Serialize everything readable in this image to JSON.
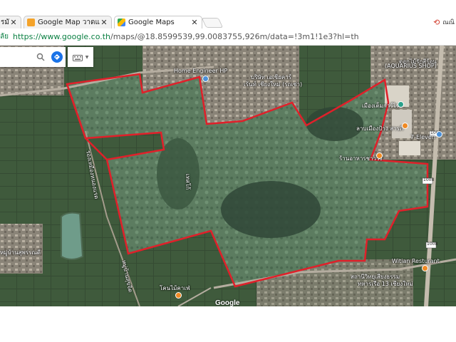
{
  "tabs": [
    {
      "label": "รมั",
      "favicon_color": "#ffffff",
      "close": "✕"
    },
    {
      "label": "Google Map วาดแปลงที่ดิน",
      "favicon_color": "#f4a32a",
      "close": "✕"
    },
    {
      "label": "Google Maps",
      "favicon_color": "#4caf50",
      "close": "✕",
      "active": true
    }
  ],
  "user_area": {
    "icon": "user-icon",
    "text": "ณณิ"
  },
  "address_bar": {
    "secure_label": "ลัย",
    "host": "https://www.google.co.th",
    "path": "/maps/@18.8599539,99.0083755,926m/data=!3m1!1e3?hl=th"
  },
  "search": {
    "value": "",
    "placeholder": ""
  },
  "map_labels": [
    {
      "text": "Home Engineer HP",
      "color": "#ffffff"
    },
    {
      "text": "บริษัท เอเชียคาร์",
      "color": "#ffffff"
    },
    {
      "text": "เร้นท์ เชียงใหม่ (รถเช่า)",
      "color": "#ffffff"
    },
    {
      "text": "ดอกไม้รักสีร้อน",
      "color": "#ffffff"
    },
    {
      "text": "(AQUARIUS SHOP)",
      "color": "#ffffff"
    },
    {
      "text": "เมืองเต็มการ์ไร่",
      "color": "#ffffff"
    },
    {
      "text": "ลาบเมืองป้าง สารภี",
      "color": "#ffffff"
    },
    {
      "text": "7-Eleven",
      "color": "#ffffff"
    },
    {
      "text": "ร้านอาหารชาววัง",
      "color": "#ffffff"
    },
    {
      "text": "Witian Resturant",
      "color": "#ffffff"
    },
    {
      "text": "สถานีวิทยุเสียงธรรม",
      "color": "#ffffff"
    },
    {
      "text": "ทหารเรือ 13 เชียงใหม่",
      "color": "#ffffff"
    },
    {
      "text": "โคนไม้คาเฟ่",
      "color": "#ffffff"
    },
    {
      "text": "หมู่บ้านสุพรรณดี",
      "color": "#ffffff"
    },
    {
      "text": "ร่องเหมืองหนองแรด",
      "color": "#ffffff"
    },
    {
      "text": "หมู่บ้านสุขจิต",
      "color": "#ffffff"
    },
    {
      "text": "เทสโก้",
      "color": "#ffffff"
    }
  ],
  "road_shields": [
    "1008",
    "1008",
    "1008"
  ],
  "google_logo": "Google",
  "colors": {
    "boundary": "#e0202a",
    "satellite_base": "#3d5238",
    "field": "#5f7f63"
  }
}
